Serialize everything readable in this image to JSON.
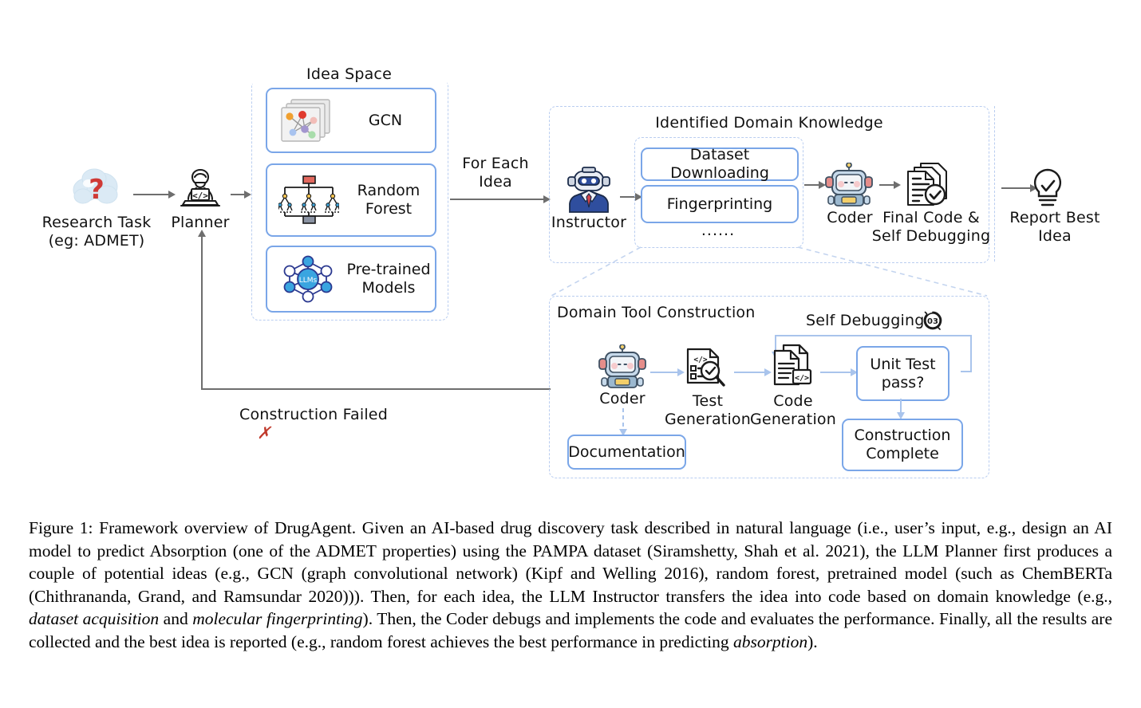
{
  "figure": {
    "number": "Figure 1:",
    "caption_parts": [
      {
        "t": "Figure 1: Framework overview of DrugAgent. Given an AI-based drug discovery task described in natural language (i.e., user’s input, e.g., design an AI model to predict Absorption (one of the ADMET properties) using the PAMPA dataset (Siramshetty, Shah et al. 2021), the LLM Planner first produces a couple of potential ideas (e.g., GCN (graph convolutional network) (Kipf and Welling 2016), random forest, pretrained model (such as ChemBERTa (Chithrananda, Grand, and Ramsundar 2020))). Then, for each idea, the LLM Instructor transfers the idea into code based on domain knowledge (e.g., ",
        "i": false
      },
      {
        "t": "dataset acquisition",
        "i": true
      },
      {
        "t": " and ",
        "i": false
      },
      {
        "t": "molecular fingerprinting",
        "i": true
      },
      {
        "t": "). Then, the Coder debugs and implements the code and evaluates the performance. Finally, all the results are collected and the best idea is reported (e.g., random forest achieves the best performance in predicting ",
        "i": false
      },
      {
        "t": "absorption",
        "i": true
      },
      {
        "t": ").",
        "i": false
      }
    ]
  },
  "diagram": {
    "stage_research_task": {
      "label": "Research Task\n(eg: ADMET)",
      "icon": "question-cloud-icon"
    },
    "stage_planner": {
      "label": "Planner",
      "icon": "planner-person-laptop-icon"
    },
    "idea_space": {
      "title": "Idea Space",
      "ideas": [
        {
          "label": "GCN",
          "icon": "graph-network-cards-icon"
        },
        {
          "label": "Random\nForest",
          "icon": "random-forest-trees-icon"
        },
        {
          "label": "Pre-trained\nModels",
          "icon": "llms-hexagon-network-icon",
          "icon_text": "LLMs"
        }
      ]
    },
    "for_each_idea_label": "For Each\nIdea",
    "stage_instructor": {
      "label": "Instructor",
      "icon": "instructor-robot-suit-icon"
    },
    "domain_knowledge": {
      "title": "Identified Domain Knowledge",
      "items": [
        {
          "label": "Dataset Downloading"
        },
        {
          "label": "Fingerprinting"
        }
      ],
      "ellipsis": "......"
    },
    "stage_coder_top": {
      "label": "Coder",
      "icon": "coder-robot-icon"
    },
    "stage_final_code": {
      "label": "Final Code &\nSelf Debugging",
      "icon": "document-check-icon"
    },
    "stage_report": {
      "label": "Report Best\nIdea",
      "icon": "lightbulb-check-icon"
    },
    "feedback": {
      "label": "Construction Failed",
      "mark": "✗"
    },
    "tool_construction": {
      "title": "Domain Tool Construction",
      "self_debugging": {
        "label": "Self Debugging",
        "badge": "03",
        "badge_icon": "loop-refresh-icon"
      },
      "coder": {
        "label": "Coder",
        "icon": "coder-robot-icon"
      },
      "test_generation": {
        "label": "Test\nGeneration",
        "icon": "test-doc-magnifier-icon"
      },
      "code_generation": {
        "label": "Code\nGeneration",
        "icon": "code-doc-icon"
      },
      "unit_test": {
        "label": "Unit Test\npass?"
      },
      "construction_complete": {
        "label": "Construction\nComplete"
      },
      "documentation": {
        "label": "Documentation"
      }
    }
  },
  "colors": {
    "box_border": "#7aa6e8",
    "dash_border": "#b9cdf0",
    "arrow_gray": "#6e6e6e",
    "arrow_blue": "#a9c4ec",
    "fail_red": "#c0392b"
  }
}
